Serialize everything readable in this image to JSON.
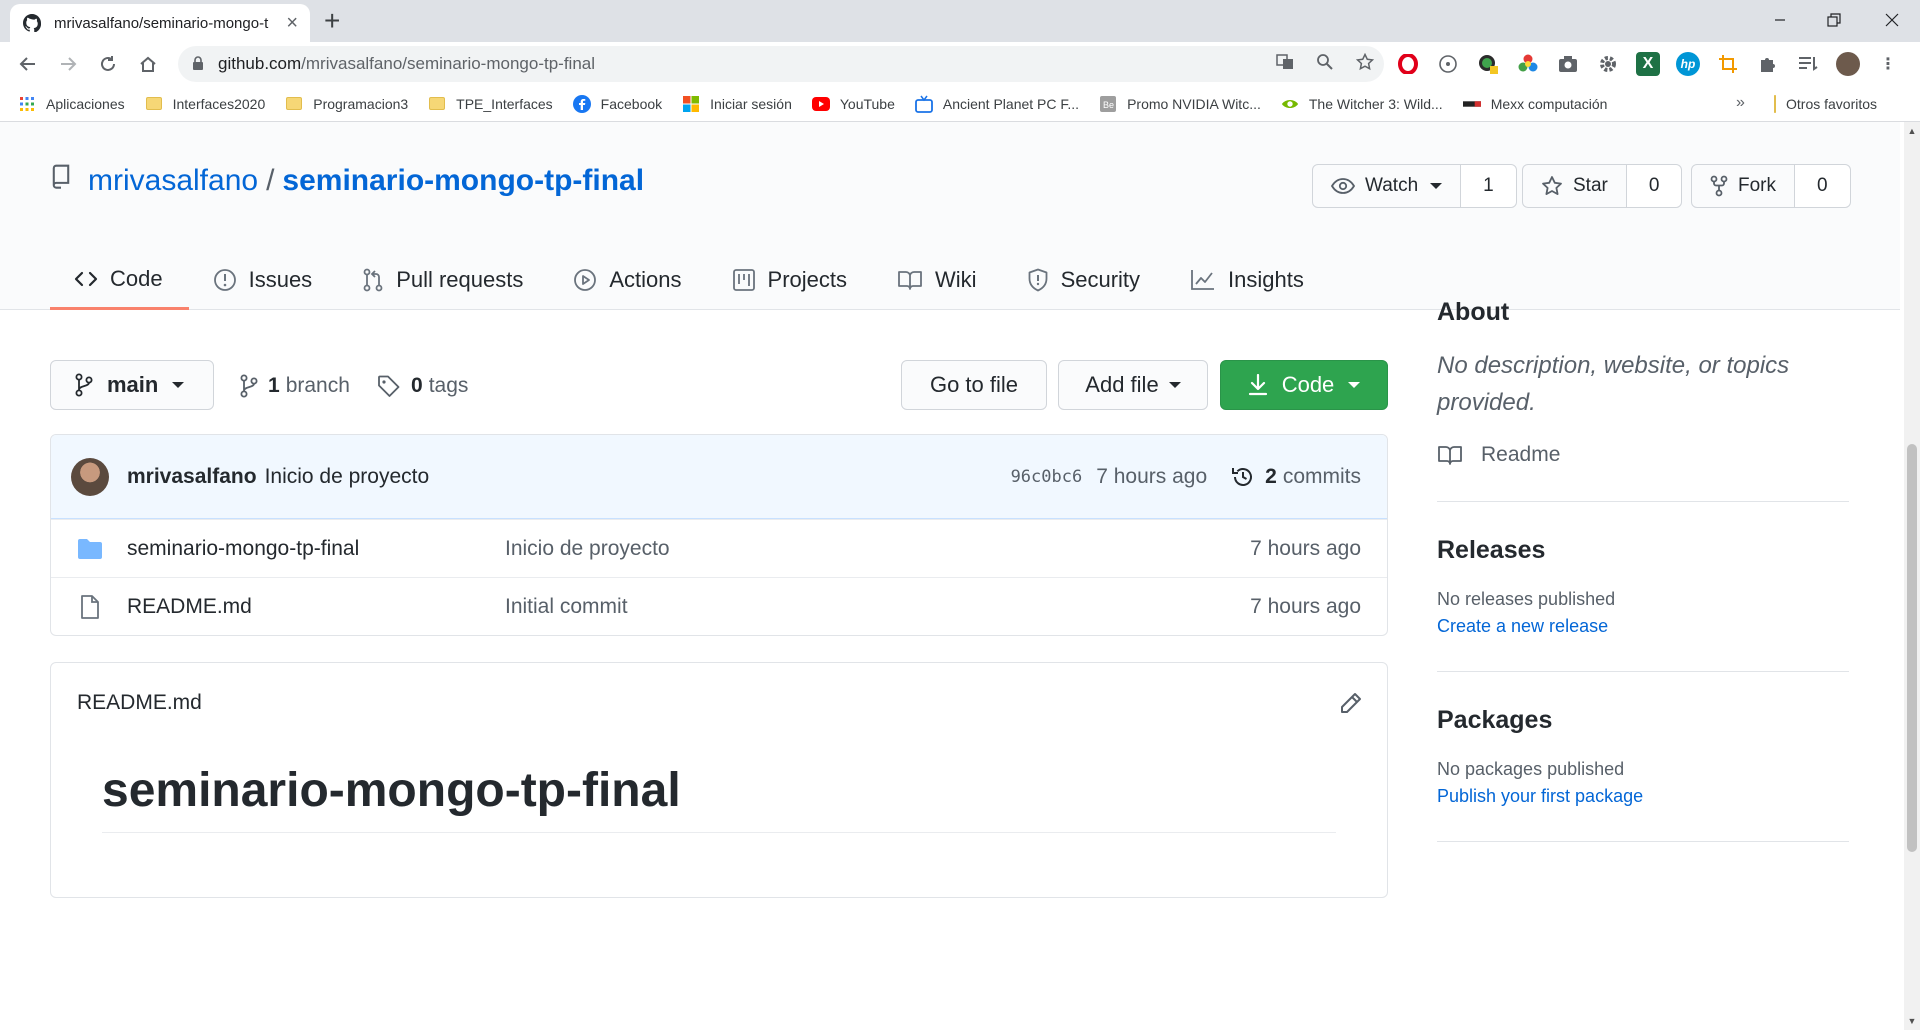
{
  "browser": {
    "tab_title": "mrivasalfano/seminario-mongo-t",
    "url_host": "github.com",
    "url_path": "/mrivasalfano/seminario-mongo-tp-final",
    "bookmarks": [
      {
        "label": "Aplicaciones",
        "icon": "apps-grid-icon"
      },
      {
        "label": "Interfaces2020",
        "icon": "folder-icon"
      },
      {
        "label": "Programacion3",
        "icon": "folder-icon"
      },
      {
        "label": "TPE_Interfaces",
        "icon": "folder-icon"
      },
      {
        "label": "Facebook",
        "icon": "facebook-icon"
      },
      {
        "label": "Iniciar sesión",
        "icon": "microsoft-icon"
      },
      {
        "label": "YouTube",
        "icon": "youtube-icon"
      },
      {
        "label": "Ancient Planet PC F...",
        "icon": "tv-icon"
      },
      {
        "label": "Promo NVIDIA Witc...",
        "icon": "site-icon"
      },
      {
        "label": "The Witcher 3: Wild...",
        "icon": "nvidia-icon"
      },
      {
        "label": "Mexx computación",
        "icon": "mexx-icon"
      }
    ],
    "bookmarks_more": "»",
    "other_bookmarks": "Otros favoritos"
  },
  "repo": {
    "owner": "mrivasalfano",
    "separator": "/",
    "name": "seminario-mongo-tp-final",
    "watch_label": "Watch",
    "watch_count": "1",
    "star_label": "Star",
    "star_count": "0",
    "fork_label": "Fork",
    "fork_count": "0"
  },
  "nav_tabs": [
    {
      "label": "Code",
      "icon": "code-icon",
      "active": true
    },
    {
      "label": "Issues",
      "icon": "issue-icon"
    },
    {
      "label": "Pull requests",
      "icon": "pull-request-icon"
    },
    {
      "label": "Actions",
      "icon": "play-icon"
    },
    {
      "label": "Projects",
      "icon": "project-icon"
    },
    {
      "label": "Wiki",
      "icon": "book-icon"
    },
    {
      "label": "Security",
      "icon": "shield-icon"
    },
    {
      "label": "Insights",
      "icon": "graph-icon"
    }
  ],
  "toolbar": {
    "branch": "main",
    "branch_count": "1",
    "branch_word": "branch",
    "tag_count": "0",
    "tag_word": "tags",
    "go_to_file": "Go to file",
    "add_file": "Add file",
    "code": "Code"
  },
  "latest_commit": {
    "author": "mrivasalfano",
    "message": "Inicio de proyecto",
    "sha": "96c0bc6",
    "age": "7 hours ago",
    "commit_count": "2",
    "commit_word": "commits"
  },
  "files": [
    {
      "name": "seminario-mongo-tp-final",
      "type": "folder",
      "message": "Inicio de proyecto",
      "age": "7 hours ago"
    },
    {
      "name": "README.md",
      "type": "file",
      "message": "Initial commit",
      "age": "7 hours ago"
    }
  ],
  "readme": {
    "filename": "README.md",
    "heading": "seminario-mongo-tp-final"
  },
  "sidebar": {
    "about_title": "About",
    "about_desc": "No description, website, or topics provided.",
    "readme_label": "Readme",
    "releases_title": "Releases",
    "releases_text": "No releases published",
    "releases_link": "Create a new release",
    "packages_title": "Packages",
    "packages_text": "No packages published",
    "packages_link": "Publish your first package"
  },
  "colors": {
    "link": "#0366d6",
    "green_button": "#2ea44f",
    "active_tab_underline": "#f9826c",
    "commit_bar": "#f1f8ff"
  }
}
